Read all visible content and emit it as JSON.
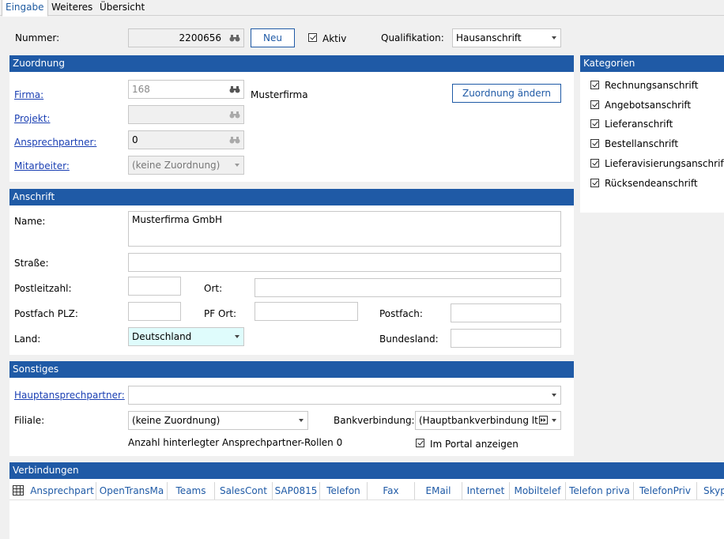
{
  "tabs": [
    "Eingabe",
    "Weiteres",
    "Übersicht"
  ],
  "header": {
    "nummer_label": "Nummer:",
    "nummer_value": "2200656",
    "neu_label": "Neu",
    "aktiv_label": "Aktiv",
    "qualifikation_label": "Qualifikation:",
    "qualifikation_value": "Hausanschrift"
  },
  "zuordnung": {
    "title": "Zuordnung",
    "firma_label": "Firma:",
    "firma_value": "168",
    "firma_name": "Musterfirma",
    "projekt_label": "Projekt:",
    "ansprechpartner_label": "Ansprechpartner:",
    "ansprechpartner_value": "0",
    "mitarbeiter_label": "Mitarbeiter:",
    "mitarbeiter_value": "(keine Zuordnung)",
    "change_button": "Zuordnung ändern"
  },
  "kategorien": {
    "title": "Kategorien",
    "items": [
      "Rechnungsanschrift",
      "Angebotsanschrift",
      "Lieferanschrift",
      "Bestellanschrift",
      "Lieferavisierungsanschrift",
      "Rücksendeanschrift"
    ]
  },
  "anschrift": {
    "title": "Anschrift",
    "name_label": "Name:",
    "name_value": "Musterfirma GmbH",
    "strasse_label": "Straße:",
    "plz_label": "Postleitzahl:",
    "ort_label": "Ort:",
    "postfach_plz_label": "Postfach PLZ:",
    "pf_ort_label": "PF Ort:",
    "postfach_label": "Postfach:",
    "land_label": "Land:",
    "land_value": "Deutschland",
    "bundesland_label": "Bundesland:"
  },
  "sonstiges": {
    "title": "Sonstiges",
    "hauptansprechpartner_label": "Hauptansprechpartner:",
    "filiale_label": "Filiale:",
    "filiale_value": "(keine Zuordnung)",
    "bank_label": "Bankverbindung:",
    "bank_value": "(Hauptbankverbindung lt.",
    "rollen_text": "Anzahl hinterlegter Ansprechpartner-Rollen 0",
    "portal_label": "Im Portal anzeigen"
  },
  "verbindungen": {
    "title": "Verbindungen",
    "columns": [
      "Ansprechpart",
      "OpenTransMa",
      "Teams",
      "SalesCont",
      "SAP0815",
      "Telefon",
      "Fax",
      "EMail",
      "Internet",
      "Mobiltelef",
      "Telefon priva",
      "TelefonPriv",
      "Skyp"
    ]
  },
  "colors": {
    "accent": "#1f5aa6",
    "link": "#1a3fb3",
    "land_bg": "#dffcfc"
  }
}
